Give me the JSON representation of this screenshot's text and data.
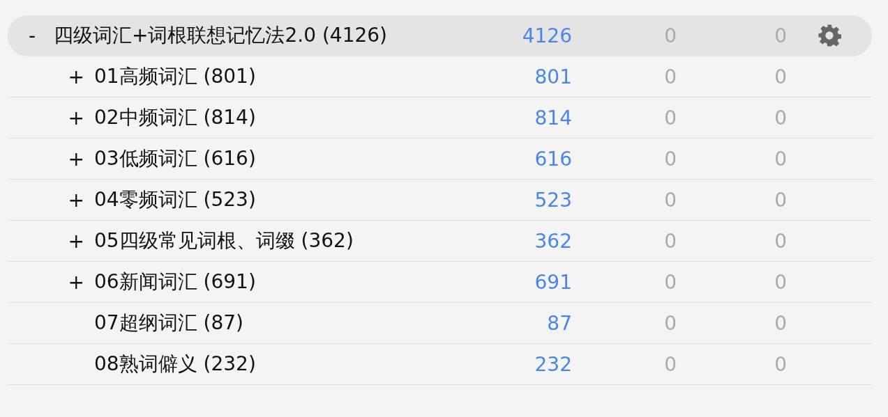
{
  "deck": {
    "toggle": "-",
    "name": "四级词汇+词根联想记忆法2.0 (4126)",
    "new": "4126",
    "learn": "0",
    "due": "0",
    "selected": true,
    "children": [
      {
        "toggle": "+",
        "name": "01高频词汇 (801)",
        "new": "801",
        "learn": "0",
        "due": "0",
        "selected": false
      },
      {
        "toggle": "+",
        "name": "02中频词汇 (814)",
        "new": "814",
        "learn": "0",
        "due": "0",
        "selected": false
      },
      {
        "toggle": "+",
        "name": "03低频词汇 (616)",
        "new": "616",
        "learn": "0",
        "due": "0",
        "selected": false
      },
      {
        "toggle": "+",
        "name": "04零频词汇 (523)",
        "new": "523",
        "learn": "0",
        "due": "0",
        "selected": false
      },
      {
        "toggle": "+",
        "name": "05四级常见词根、词缀 (362)",
        "new": "362",
        "learn": "0",
        "due": "0",
        "selected": false
      },
      {
        "toggle": "+",
        "name": "06新闻词汇 (691)",
        "new": "691",
        "learn": "0",
        "due": "0",
        "selected": false
      },
      {
        "name": "07超纲词汇 (87)",
        "new": "87",
        "learn": "0",
        "due": "0",
        "selected": false
      },
      {
        "name": "08熟词僻义 (232)",
        "new": "232",
        "learn": "0",
        "due": "0",
        "selected": false
      }
    ]
  }
}
